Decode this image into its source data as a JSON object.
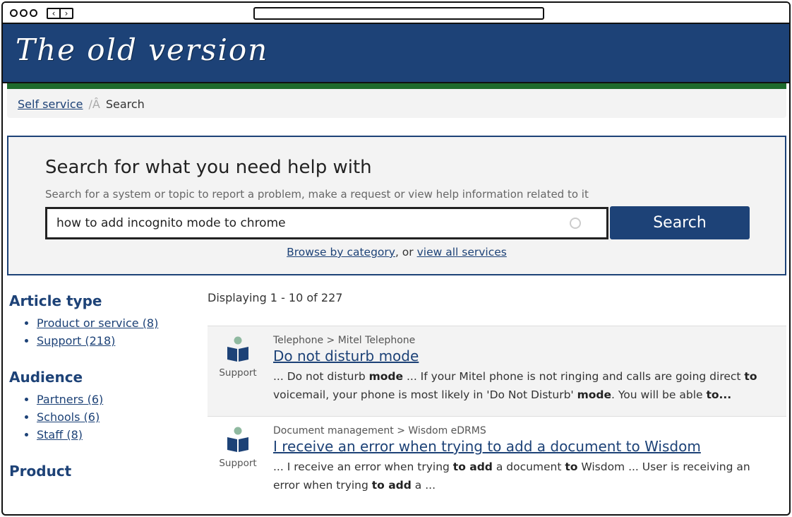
{
  "banner": {
    "title": "The old version"
  },
  "breadcrumb": {
    "parent": "Self service",
    "separator": "/Â",
    "current": "Search"
  },
  "search": {
    "heading": "Search for what you need help with",
    "subheading": "Search for a system or topic to report a problem, make a request or view help information related to it",
    "query": "how to add incognito mode to chrome",
    "button_label": "Search",
    "browse_link": "Browse by category",
    "browse_middle": ", or ",
    "all_services_link": "view all services"
  },
  "facets": [
    {
      "title": "Article type",
      "items": [
        "Product or service (8)",
        "Support (218)"
      ]
    },
    {
      "title": "Audience",
      "items": [
        "Partners (6)",
        "Schools (6)",
        "Staff (8)"
      ]
    },
    {
      "title": "Product",
      "items": []
    }
  ],
  "results": {
    "summary": "Displaying 1 - 10 of 227",
    "items": [
      {
        "category": "Telephone > Mitel Telephone",
        "title": "Do not disturb mode",
        "type": "Support",
        "icon": "book-reader-icon",
        "snippet": [
          {
            "t": "... Do not disturb ",
            "b": false
          },
          {
            "t": "mode",
            "b": true
          },
          {
            "t": " ... If your Mitel phone is not ringing and calls are going direct ",
            "b": false
          },
          {
            "t": "to",
            "b": true
          },
          {
            "t": " voicemail, your phone is most likely in 'Do Not Disturb' ",
            "b": false
          },
          {
            "t": "mode",
            "b": true
          },
          {
            "t": ". You will be able ",
            "b": false
          },
          {
            "t": "to...",
            "b": true
          }
        ]
      },
      {
        "category": "Document management > Wisdom eDRMS",
        "title": "I receive an error when trying to add a document to Wisdom",
        "type": "Support",
        "icon": "book-reader-icon",
        "snippet": [
          {
            "t": "... I receive an error when trying ",
            "b": false
          },
          {
            "t": "to add",
            "b": true
          },
          {
            "t": " a document ",
            "b": false
          },
          {
            "t": "to",
            "b": true
          },
          {
            "t": " Wisdom ... User is receiving an error when trying ",
            "b": false
          },
          {
            "t": "to add",
            "b": true
          },
          {
            "t": " a ...",
            "b": false
          }
        ]
      }
    ]
  },
  "colors": {
    "brand": "#1d4277",
    "accent_strip": "#1e6b2c",
    "panel_bg": "#f3f3f3"
  }
}
